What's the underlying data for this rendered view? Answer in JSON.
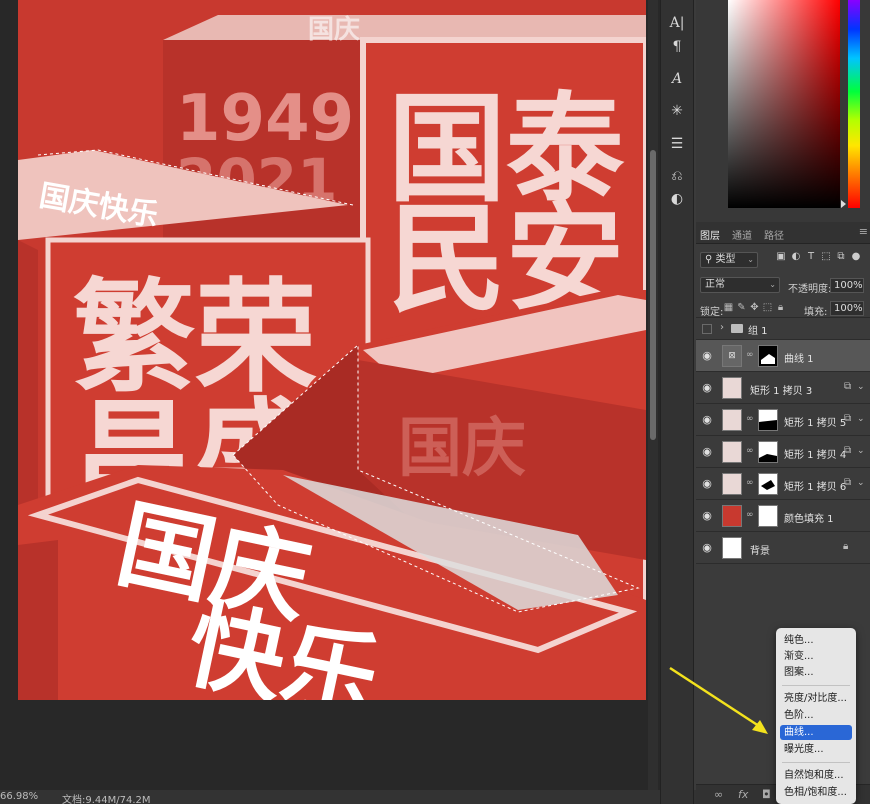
{
  "canvas": {
    "zoom_label": "66.98%",
    "doc_info": "文档:9.44M/74.2M",
    "artwork_text": {
      "year": "1949",
      "year_partial": "2021",
      "box_right_line1": "国泰",
      "box_right_line2": "民安",
      "box_left_line1": "繁荣",
      "box_left_line2": "昌盛",
      "box_top_small": "国庆快乐",
      "box_front_line1": "国庆",
      "box_front_line2": "快乐",
      "box_mid_side": "国庆"
    }
  },
  "toolstrip": {
    "icons": [
      "character-icon",
      "paragraph-icon",
      "glyphs-icon",
      "brightness-icon",
      "adjustments-icon",
      "history-icon",
      "styles-icon"
    ]
  },
  "colors": {
    "artboard_red": "#c8392f",
    "selection_accent": "#2a67d6",
    "arrow_yellow": "#f3e21d"
  },
  "layers_panel": {
    "tabs": [
      "图层",
      "通道",
      "路径"
    ],
    "active_tab": "图层",
    "filter_value": "类型",
    "blend_mode": "正常",
    "opacity_label": "不透明度:",
    "opacity_value": "100%",
    "lock_label": "锁定:",
    "fill_label": "填充:",
    "fill_value": "100%",
    "layers": [
      {
        "name": "组 1",
        "type": "group",
        "visible": false
      },
      {
        "name": "曲线 1",
        "type": "adjustment",
        "visible": true,
        "selected": true
      },
      {
        "name": "矩形 1 拷贝 3",
        "type": "smart",
        "visible": true
      },
      {
        "name": "矩形 1 拷贝 5",
        "type": "smart-masked",
        "visible": true
      },
      {
        "name": "矩形 1 拷贝 4",
        "type": "smart-masked",
        "visible": true
      },
      {
        "name": "矩形 1 拷贝 6",
        "type": "smart-masked",
        "visible": true
      },
      {
        "name": "颜色填充 1",
        "type": "fill",
        "visible": true
      },
      {
        "name": "背景",
        "type": "background",
        "visible": true,
        "locked": true
      }
    ]
  },
  "adjustment_menu": {
    "items": [
      "纯色...",
      "渐变...",
      "图案...",
      "亮度/对比度...",
      "色阶...",
      "曲线...",
      "曝光度...",
      "自然饱和度...",
      "色相/饱和度..."
    ],
    "highlighted": "曲线..."
  }
}
